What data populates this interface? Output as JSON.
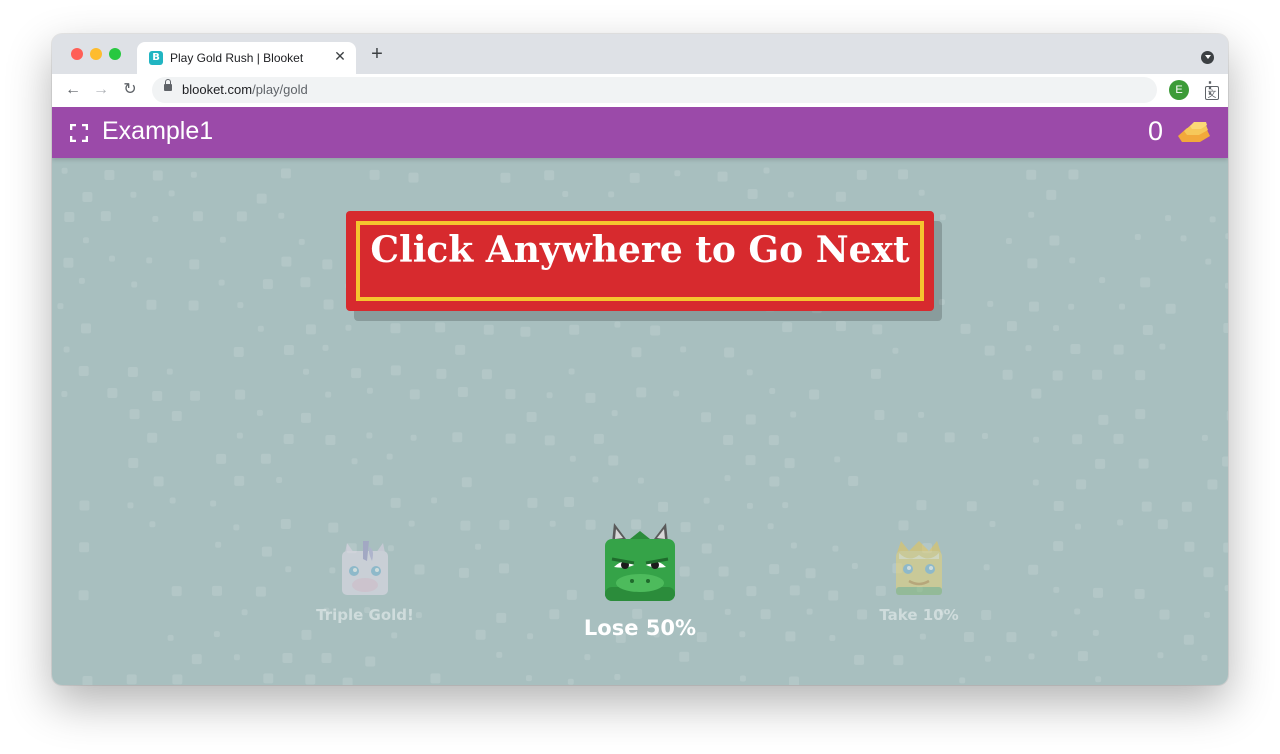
{
  "browser": {
    "tab": {
      "title": "Play Gold Rush | Blooket",
      "favicon_letter": "B",
      "close_glyph": "✕"
    },
    "new_tab_glyph": "+",
    "url_host": "blooket.com",
    "url_path": "/play/gold",
    "profile_initial": "E",
    "icons": [
      "back-icon",
      "forward-icon",
      "reload-icon",
      "lock-icon",
      "translate-icon",
      "star-icon",
      "menu-icon"
    ]
  },
  "game": {
    "name": "Example1",
    "gold": "0",
    "banner_text": "Click Anywhere to Go Next",
    "choices": [
      {
        "label": "Triple Gold!",
        "character": "unicorn",
        "selected": false
      },
      {
        "label": "Lose 50%",
        "character": "dragon",
        "selected": true
      },
      {
        "label": "Take 10%",
        "character": "king",
        "selected": false
      }
    ]
  },
  "colors": {
    "topbar": "#9b4aa9",
    "background": "#a8bfbf",
    "banner": "#d72a2e",
    "banner_border": "#f5c52f"
  }
}
